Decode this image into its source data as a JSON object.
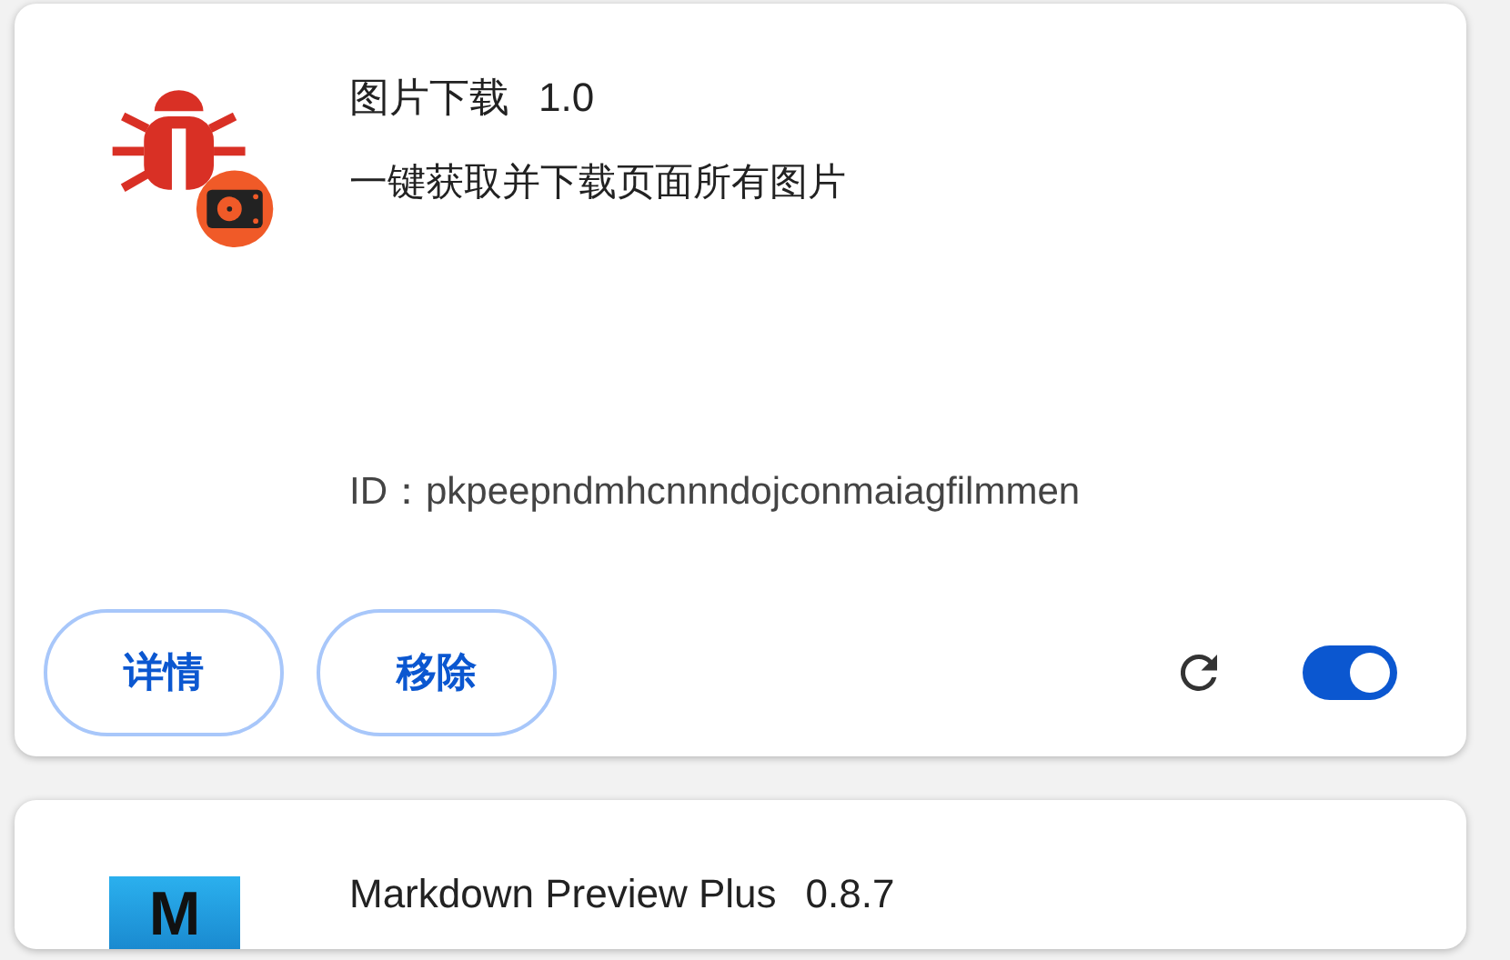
{
  "extensions": [
    {
      "name": "图片下载",
      "version": "1.0",
      "description": "一键获取并下载页面所有图片",
      "id_label": "ID：",
      "id": "pkpeepndmhcnnndojconmaiagfilmmen",
      "kind": "bug",
      "buttons": [
        "详情",
        "移除"
      ],
      "enabled": true
    },
    {
      "name": "Markdown Preview Plus",
      "version": "0.8.7",
      "kind": "letter",
      "icon_letter": "M"
    }
  ]
}
